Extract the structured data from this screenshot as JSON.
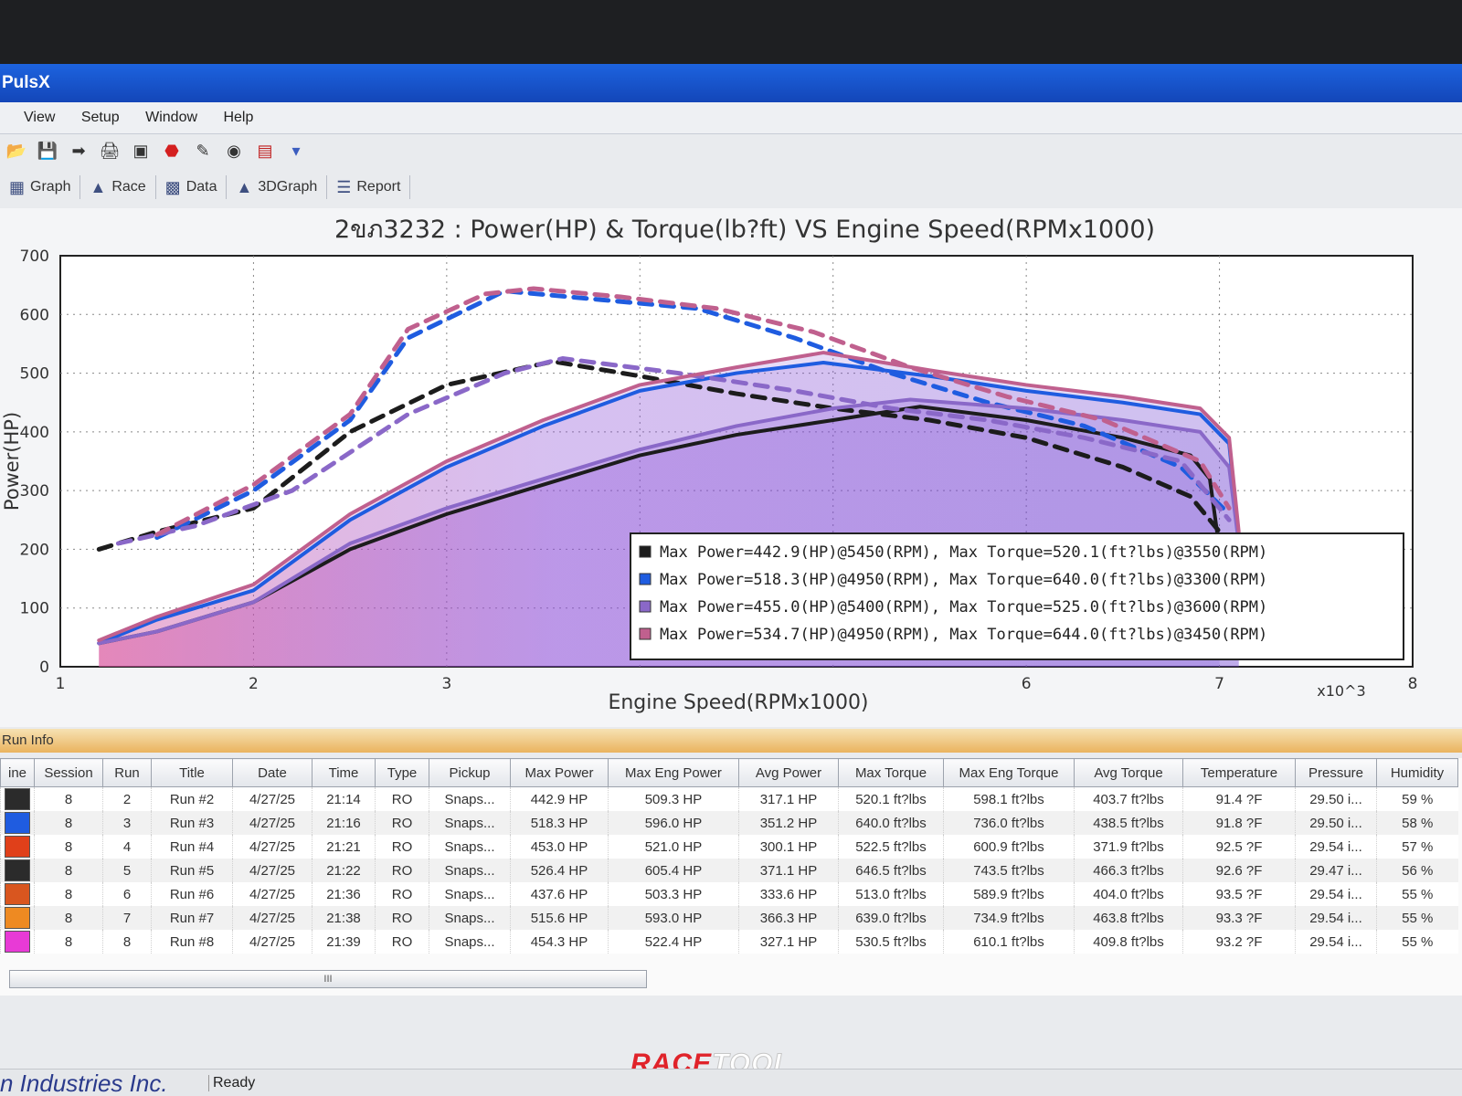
{
  "window": {
    "title": "PulsX"
  },
  "menu": [
    "View",
    "Setup",
    "Window",
    "Help"
  ],
  "toolbar_icons": [
    "open-icon",
    "save-icon",
    "export-icon",
    "print-icon",
    "window-icon",
    "record-icon",
    "run-icon",
    "gauge-icon",
    "display-icon",
    "dropdown-icon"
  ],
  "tabs": [
    {
      "label": "Graph",
      "icon": "graph-icon"
    },
    {
      "label": "Race",
      "icon": "race-icon"
    },
    {
      "label": "Data",
      "icon": "data-icon"
    },
    {
      "label": "3DGraph",
      "icon": "3dgraph-icon"
    },
    {
      "label": "Report",
      "icon": "report-icon"
    }
  ],
  "chart_data": {
    "type": "line",
    "title": "2ขภ3232 : Power(HP) & Torque(lb?ft) VS Engine Speed(RPMx1000)",
    "xlabel": "Engine Speed(RPMx1000)",
    "ylabel": "Power(HP)",
    "x_multiplier_label": "x10^3",
    "xlim": [
      1,
      8
    ],
    "ylim": [
      0,
      700
    ],
    "x_ticks": [
      1,
      2,
      3,
      6,
      7,
      8
    ],
    "y_ticks": [
      0,
      100,
      200,
      300,
      400,
      500,
      600,
      700
    ],
    "grid": true,
    "legend_position": "bottom-right",
    "series": [
      {
        "color": "#1c1c1c",
        "style": "solid",
        "kind": "power",
        "x": [
          1.2,
          1.5,
          2.0,
          2.5,
          3.0,
          3.5,
          4.0,
          4.5,
          5.0,
          5.45,
          6.0,
          6.5,
          6.85,
          6.95,
          7.0
        ],
        "y": [
          40,
          60,
          110,
          200,
          260,
          310,
          360,
          395,
          420,
          443,
          420,
          390,
          360,
          320,
          200
        ]
      },
      {
        "color": "#1c1c1c",
        "style": "dashed",
        "kind": "torque",
        "x": [
          1.2,
          1.5,
          2.0,
          2.5,
          3.0,
          3.55,
          4.0,
          4.5,
          5.0,
          5.5,
          6.0,
          6.5,
          6.85,
          7.0
        ],
        "y": [
          200,
          230,
          270,
          400,
          480,
          520,
          495,
          465,
          440,
          420,
          390,
          340,
          290,
          230
        ]
      },
      {
        "color": "#1f5ce0",
        "style": "solid",
        "kind": "power",
        "x": [
          1.2,
          1.5,
          2.0,
          2.5,
          3.0,
          3.5,
          4.0,
          4.5,
          4.95,
          5.5,
          6.0,
          6.5,
          6.9,
          7.05,
          7.1
        ],
        "y": [
          40,
          80,
          130,
          250,
          340,
          410,
          470,
          500,
          518,
          495,
          470,
          450,
          430,
          380,
          220
        ]
      },
      {
        "color": "#1f5ce0",
        "style": "dashed",
        "kind": "torque",
        "x": [
          1.5,
          2.0,
          2.5,
          2.8,
          3.3,
          3.8,
          4.3,
          4.8,
          5.3,
          5.8,
          6.3,
          6.8,
          7.05
        ],
        "y": [
          220,
          300,
          420,
          560,
          640,
          625,
          610,
          560,
          500,
          450,
          410,
          340,
          260
        ]
      },
      {
        "color": "#8a68c8",
        "style": "solid",
        "kind": "power",
        "x": [
          1.2,
          1.5,
          2.0,
          2.5,
          3.0,
          3.5,
          4.0,
          4.5,
          5.0,
          5.4,
          6.0,
          6.5,
          6.9,
          7.05,
          7.1
        ],
        "y": [
          40,
          60,
          110,
          210,
          270,
          320,
          370,
          410,
          440,
          455,
          440,
          420,
          400,
          340,
          210
        ]
      },
      {
        "color": "#8a68c8",
        "style": "dashed",
        "kind": "torque",
        "x": [
          1.3,
          1.7,
          2.2,
          2.8,
          3.3,
          3.6,
          4.2,
          4.8,
          5.3,
          5.8,
          6.3,
          6.8,
          7.05
        ],
        "y": [
          210,
          240,
          300,
          430,
          500,
          525,
          500,
          470,
          440,
          420,
          390,
          350,
          250
        ]
      },
      {
        "color": "#c0608e",
        "style": "solid",
        "kind": "power",
        "x": [
          1.2,
          1.5,
          2.0,
          2.5,
          3.0,
          3.5,
          4.0,
          4.5,
          4.95,
          5.5,
          6.0,
          6.5,
          6.9,
          7.05,
          7.1
        ],
        "y": [
          45,
          85,
          140,
          260,
          350,
          420,
          480,
          510,
          535,
          505,
          480,
          460,
          440,
          390,
          230
        ]
      },
      {
        "color": "#c0608e",
        "style": "dashed",
        "kind": "torque",
        "x": [
          1.5,
          2.0,
          2.5,
          2.8,
          3.2,
          3.45,
          3.9,
          4.4,
          4.9,
          5.4,
          5.9,
          6.4,
          6.9,
          7.05
        ],
        "y": [
          225,
          310,
          430,
          575,
          635,
          644,
          630,
          610,
          570,
          510,
          460,
          420,
          350,
          270
        ]
      }
    ],
    "legend": [
      {
        "color": "#1c1c1c",
        "text": "Max Power=442.9(HP)@5450(RPM), Max Torque=520.1(ft?lbs)@3550(RPM)"
      },
      {
        "color": "#1f5ce0",
        "text": "Max Power=518.3(HP)@4950(RPM), Max Torque=640.0(ft?lbs)@3300(RPM)"
      },
      {
        "color": "#8a68c8",
        "text": "Max Power=455.0(HP)@5400(RPM), Max Torque=525.0(ft?lbs)@3600(RPM)"
      },
      {
        "color": "#c0608e",
        "text": "Max Power=534.7(HP)@4950(RPM), Max Torque=644.0(ft?lbs)@3450(RPM)"
      }
    ]
  },
  "runinfo": {
    "title": "Run Info",
    "columns": [
      "ine",
      "Session",
      "Run",
      "Title",
      "Date",
      "Time",
      "Type",
      "Pickup",
      "Max Power",
      "Max Eng Power",
      "Avg Power",
      "Max Torque",
      "Max Eng Torque",
      "Avg Torque",
      "Temperature",
      "Pressure",
      "Humidity"
    ],
    "rows": [
      {
        "color": "#2b2b2b",
        "session": "8",
        "run": "2",
        "title": "Run #2",
        "date": "4/27/25",
        "time": "21:14",
        "type": "RO",
        "pickup": "Snaps...",
        "max_power": "442.9 HP",
        "max_eng_power": "509.3 HP",
        "avg_power": "317.1 HP",
        "max_torque": "520.1 ft?lbs",
        "max_eng_torque": "598.1 ft?lbs",
        "avg_torque": "403.7 ft?lbs",
        "temperature": "91.4 ?F",
        "pressure": "29.50 i...",
        "humidity": "59 %"
      },
      {
        "color": "#1f5ce0",
        "session": "8",
        "run": "3",
        "title": "Run #3",
        "date": "4/27/25",
        "time": "21:16",
        "type": "RO",
        "pickup": "Snaps...",
        "max_power": "518.3 HP",
        "max_eng_power": "596.0 HP",
        "avg_power": "351.2 HP",
        "max_torque": "640.0 ft?lbs",
        "max_eng_torque": "736.0 ft?lbs",
        "avg_torque": "438.5 ft?lbs",
        "temperature": "91.8 ?F",
        "pressure": "29.50 i...",
        "humidity": "58 %"
      },
      {
        "color": "#e0401a",
        "session": "8",
        "run": "4",
        "title": "Run #4",
        "date": "4/27/25",
        "time": "21:21",
        "type": "RO",
        "pickup": "Snaps...",
        "max_power": "453.0 HP",
        "max_eng_power": "521.0 HP",
        "avg_power": "300.1 HP",
        "max_torque": "522.5 ft?lbs",
        "max_eng_torque": "600.9 ft?lbs",
        "avg_torque": "371.9 ft?lbs",
        "temperature": "92.5 ?F",
        "pressure": "29.54 i...",
        "humidity": "57 %"
      },
      {
        "color": "#2b2b2b",
        "session": "8",
        "run": "5",
        "title": "Run #5",
        "date": "4/27/25",
        "time": "21:22",
        "type": "RO",
        "pickup": "Snaps...",
        "max_power": "526.4 HP",
        "max_eng_power": "605.4 HP",
        "avg_power": "371.1 HP",
        "max_torque": "646.5 ft?lbs",
        "max_eng_torque": "743.5 ft?lbs",
        "avg_torque": "466.3 ft?lbs",
        "temperature": "92.6 ?F",
        "pressure": "29.47 i...",
        "humidity": "56 %"
      },
      {
        "color": "#d9561f",
        "session": "8",
        "run": "6",
        "title": "Run #6",
        "date": "4/27/25",
        "time": "21:36",
        "type": "RO",
        "pickup": "Snaps...",
        "max_power": "437.6 HP",
        "max_eng_power": "503.3 HP",
        "avg_power": "333.6 HP",
        "max_torque": "513.0 ft?lbs",
        "max_eng_torque": "589.9 ft?lbs",
        "avg_torque": "404.0 ft?lbs",
        "temperature": "93.5 ?F",
        "pressure": "29.54 i...",
        "humidity": "55 %"
      },
      {
        "color": "#ee8a22",
        "session": "8",
        "run": "7",
        "title": "Run #7",
        "date": "4/27/25",
        "time": "21:38",
        "type": "RO",
        "pickup": "Snaps...",
        "max_power": "515.6 HP",
        "max_eng_power": "593.0 HP",
        "avg_power": "366.3 HP",
        "max_torque": "639.0 ft?lbs",
        "max_eng_torque": "734.9 ft?lbs",
        "avg_torque": "463.8 ft?lbs",
        "temperature": "93.3 ?F",
        "pressure": "29.54 i...",
        "humidity": "55 %"
      },
      {
        "color": "#e83ad6",
        "session": "8",
        "run": "8",
        "title": "Run #8",
        "date": "4/27/25",
        "time": "21:39",
        "type": "RO",
        "pickup": "Snaps...",
        "max_power": "454.3 HP",
        "max_eng_power": "522.4 HP",
        "avg_power": "327.1 HP",
        "max_torque": "530.5 ft?lbs",
        "max_eng_torque": "610.1 ft?lbs",
        "avg_torque": "409.8 ft?lbs",
        "temperature": "93.2 ?F",
        "pressure": "29.54 i...",
        "humidity": "55 %"
      }
    ]
  },
  "scrollbar": {
    "grip": "III"
  },
  "status": {
    "company": "n Industries Inc.",
    "ready": "Ready"
  },
  "watermark": {
    "part1": "RACE",
    "part2": "TOOL"
  }
}
